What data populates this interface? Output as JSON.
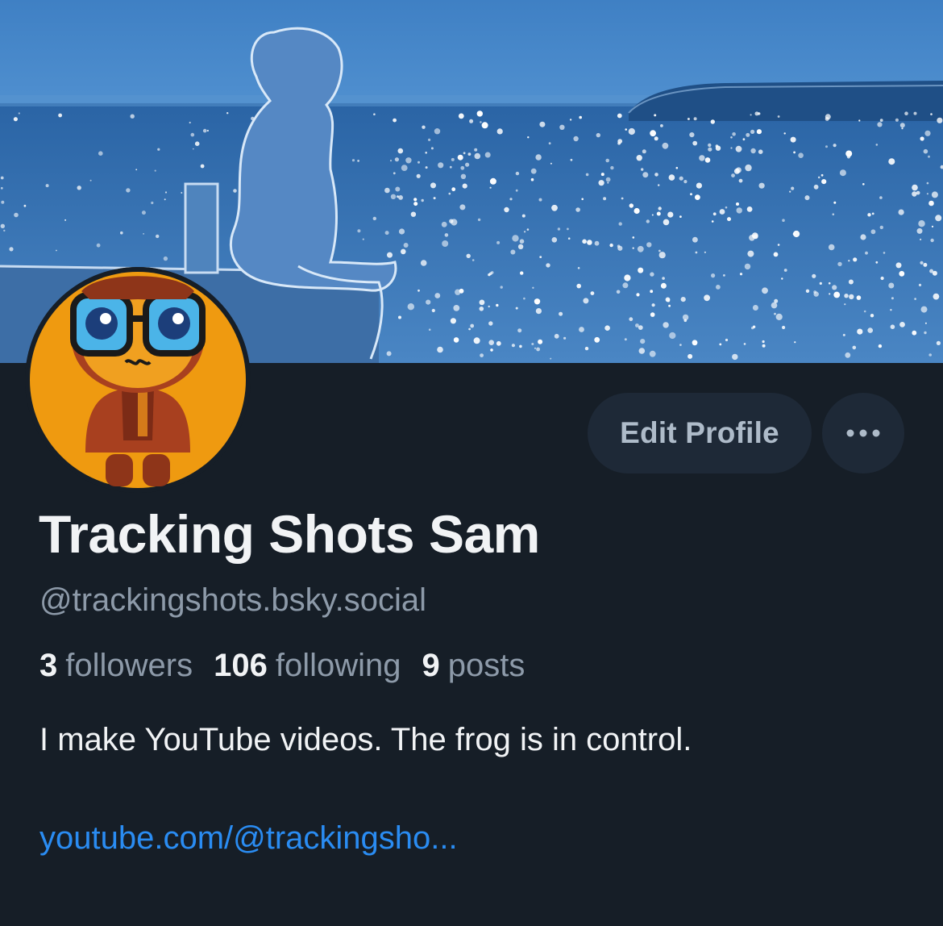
{
  "profile": {
    "display_name": "Tracking Shots Sam",
    "handle": "@trackingshots.bsky.social",
    "bio": "I make YouTube videos. The frog is in control.",
    "link": "youtube.com/@trackingsho..."
  },
  "stats": {
    "followers_count": "3",
    "followers_label": "followers",
    "following_count": "106",
    "following_label": "following",
    "posts_count": "9",
    "posts_label": "posts"
  },
  "actions": {
    "edit_profile_label": "Edit Profile",
    "more_icon": "more-horizontal-icon"
  },
  "colors": {
    "background": "#161e27",
    "button_bg": "#1e2937",
    "primary_text": "#f1f3f5",
    "secondary_text": "#8d9aa9",
    "link": "#2a8cf2",
    "avatar_bg": "#ef9a10"
  }
}
